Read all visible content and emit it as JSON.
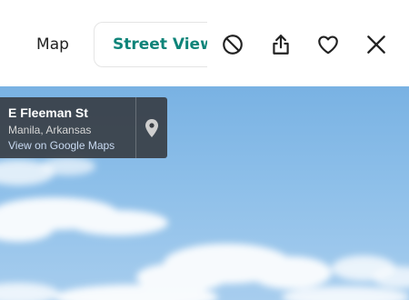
{
  "tabs": {
    "map_label": "Map",
    "street_view_label": "Street View"
  },
  "actions": {
    "hide_icon": "block-icon",
    "share_icon": "share-icon",
    "favorite_icon": "heart-icon",
    "close_icon": "close-icon"
  },
  "location_card": {
    "street": "E Fleeman St",
    "place": "Manila, Arkansas",
    "link": "View on Google Maps",
    "pin_icon": "map-pin-icon"
  },
  "colors": {
    "accent": "#0e8479",
    "sky": "#8dbfe9",
    "card": "#34383e"
  }
}
